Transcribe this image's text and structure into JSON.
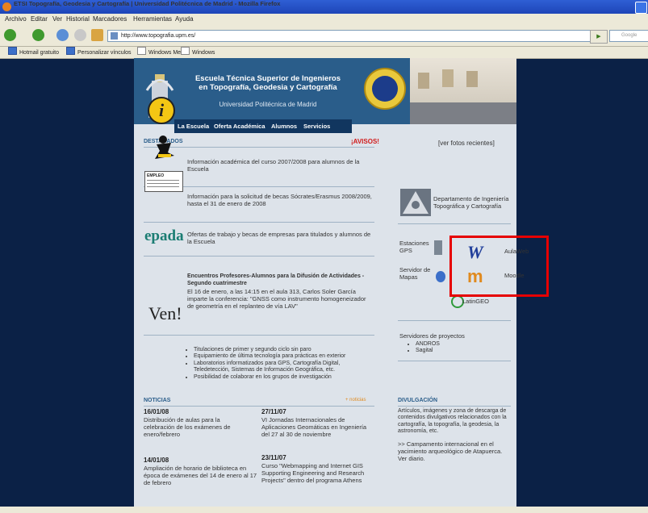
{
  "window": {
    "title": "ETSI Topografía, Geodesia y Cartografía | Universidad Politécnica de Madrid - Mozilla Firefox"
  },
  "menu": [
    "Archivo",
    "Editar",
    "Ver",
    "Historial",
    "Marcadores",
    "Herramientas",
    "Ayuda"
  ],
  "nav": {
    "url": "http://www.topografia.upm.es/",
    "search_placeholder": "Google"
  },
  "bookmarks": [
    "Hotmail gratuito",
    "Personalizar vínculos",
    "Windows Media",
    "Windows"
  ],
  "header": {
    "title_line1": "Escuela Técnica Superior de Ingenieros",
    "title_line2": "en Topografía, Geodesia y Cartografía",
    "subtitle": "Universidad Politécnica de Madrid",
    "nav": [
      "La Escuela",
      "Oferta Académica",
      "Alumnos",
      "Servicios"
    ]
  },
  "destacados": {
    "heading": "DESTACADOS",
    "avisos": "¡AVISOS!",
    "items": [
      "Información académica del curso 2007/2008 para alumnos de la Escuela",
      "Información para la solicitud de becas Sócrates/Erasmus 2008/2009, hasta el 31 de enero de 2008",
      "Ofertas de trabajo y becas de empresas para titulados y alumnos de la Escuela"
    ],
    "empleo_label": "EMPLEO",
    "epada_logo": "epada",
    "encuentros_title": "Encuentros Profesores-Alumnos para la Difusión de Actividades - Segundo cuatrimestre",
    "encuentros_body": "El 16 de enero, a las 14:15 en el aula 313, Carlos Soler García imparte la conferencia: \"GNSS como instrumento homogeneizador de geometría en el replanteo de vía LAV\"",
    "ven_logo": "Ven!",
    "ven_bullets": [
      "Titulaciones de primer y segundo ciclo sin paro",
      "Equipamiento de última tecnología para prácticas en exterior",
      "Laboratorios informatizados para GPS, Cartografía Digital, Teledetección, Sistemas de Información Geográfica, etc.",
      "Posibilidad de colaborar en los grupos de investigación"
    ]
  },
  "right": {
    "fotos_link": "[ver fotos recientes]",
    "departamento": "Departamento de Ingeniería Topográfica y Cartografía",
    "estaciones": "Estaciones GPS",
    "servidor": "Servidor de Mapas",
    "aulaweb": "AulaWeb",
    "moodle": "Moodle",
    "latingeo": "LatinGEO",
    "servidores_title": "Servidores de proyectos",
    "servidores": [
      "ANDROS",
      "Sagital"
    ]
  },
  "noticias": {
    "heading": "NOTICIAS",
    "more": "+ noticias",
    "items": [
      {
        "date": "16/01/08",
        "text": "Distribución de aulas para la celebración de los exámenes de enero/febrero"
      },
      {
        "date": "27/11/07",
        "text": "VI Jornadas Internacionales de Aplicaciones Geomáticas en Ingeniería del 27 al 30 de noviembre"
      },
      {
        "date": "14/01/08",
        "text": "Ampliación de horario de biblioteca en época de exámenes del 14 de enero al 17 de febrero"
      },
      {
        "date": "23/11/07",
        "text": "Curso \"Webmapping and Internet GIS Supporting Engineering and Research Projects\" dentro del programa Athens"
      }
    ]
  },
  "divulgacion": {
    "heading": "DIVULGACIÓN",
    "text1": "Artículos, imágenes y zona de descarga de contenidos divulgativos relacionados con la cartografía, la topografía, la geodesia, la astronomía, etc.",
    "text2": ">> Campamento internacional en el yacimiento arqueológico de Atapuerca. Ver diario."
  }
}
